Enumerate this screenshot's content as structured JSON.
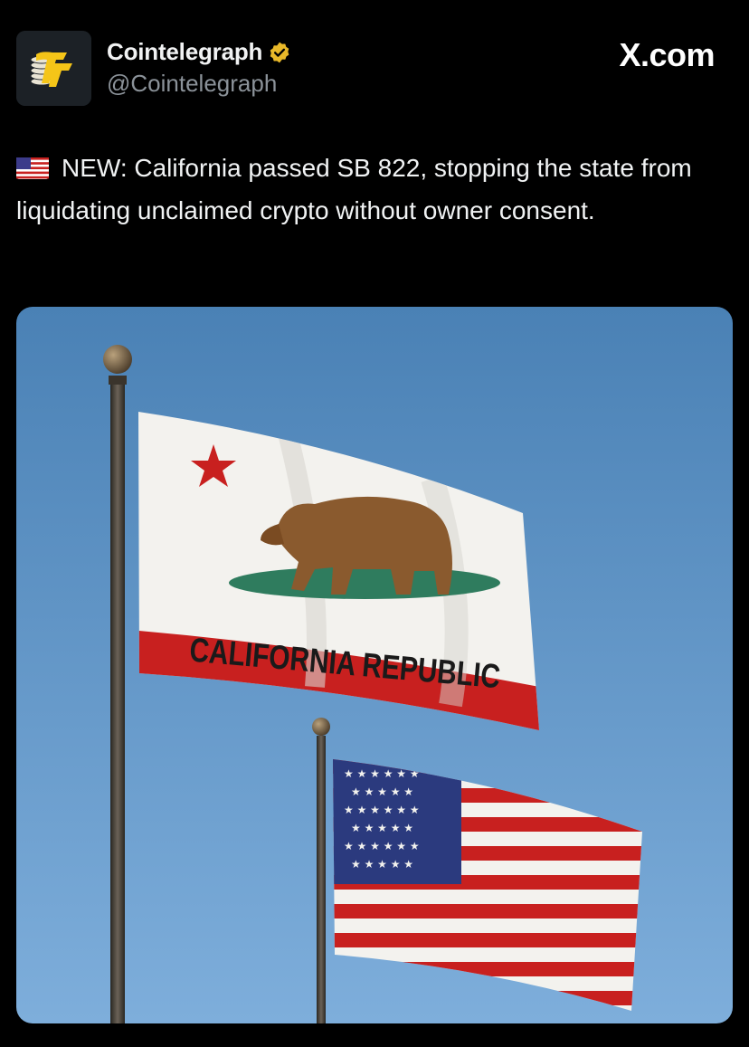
{
  "account": {
    "display_name": "Cointelegraph",
    "handle": "@Cointelegraph",
    "verified": true,
    "avatar_icon": "cointelegraph-logo",
    "badge_icon": "verified-badge-icon"
  },
  "source_logo": "X.com",
  "tweet": {
    "flag_icon": "us-flag-emoji-icon",
    "text": "NEW: California passed SB 822, stopping the state from liquidating unclaimed crypto without owner consent."
  },
  "media": {
    "flag_text": "CALIFORNIA REPUBLIC"
  },
  "colors": {
    "background": "#000000",
    "brand_yellow": "#f5c518",
    "verified_gold": "#e8b829",
    "sky": "#5f93c2",
    "flag_red": "#c8201f"
  }
}
